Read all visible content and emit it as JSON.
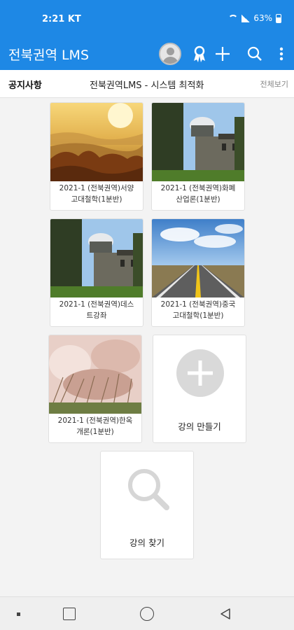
{
  "status": {
    "time": "2:21 KT",
    "battery": "63%"
  },
  "app": {
    "title": "전북권역 LMS"
  },
  "icons": {
    "avatar": "avatar-icon",
    "ribbon": "ribbon-icon",
    "add": "plus-icon",
    "search": "search-icon",
    "more": "more-vertical-icon"
  },
  "notice": {
    "label": "공지사항",
    "text": "전북권역LMS - 시스템 최적화",
    "view_all": "전체보기"
  },
  "courses": [
    {
      "line1": "2021-1 (전북권역)서양",
      "line2": "고대철학(1분반)"
    },
    {
      "line1": "2021-1 (전북권역)화폐",
      "line2": "산업론(1분반)"
    },
    {
      "line1": "2021-1 (전북권역)데스",
      "line2": "트강좌"
    },
    {
      "line1": "2021-1 (전북권역)중국",
      "line2": "고대철학(1분반)"
    },
    {
      "line1": "2021-1 (전북권역)한옥",
      "line2": "개론(1분반)"
    }
  ],
  "actions": {
    "create": "강의 만들기",
    "find": "강의 찾기"
  },
  "colors": {
    "primary": "#1e88e5",
    "background": "#f3f3f3"
  }
}
